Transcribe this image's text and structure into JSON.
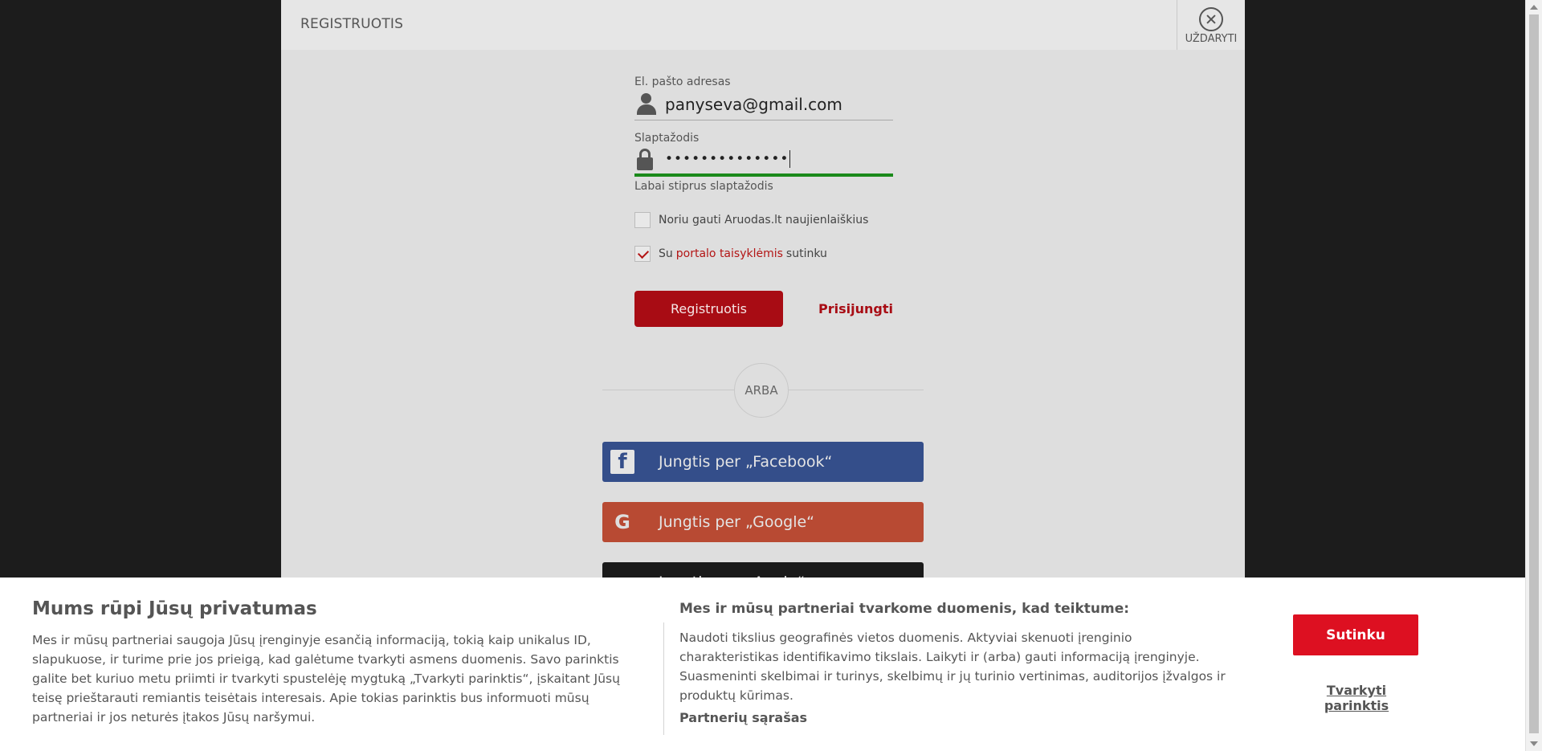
{
  "modal": {
    "title": "REGISTRUOTIS",
    "close_label": "UŽDARYTI"
  },
  "form": {
    "email_label": "El. pašto adresas",
    "email_value": "panyseva@gmail.com",
    "password_label": "Slaptažodis",
    "password_value": "••••••••••••••",
    "strength_text": "Labai stiprus slaptažodis",
    "newsletter_label": "Noriu gauti Aruodas.lt naujienlaiškius",
    "newsletter_checked": false,
    "terms_prefix": "Su",
    "terms_link": "portalo taisyklėmis",
    "terms_suffix": "sutinku",
    "terms_checked": true,
    "register_label": "Registruotis",
    "login_label": "Prisijungti"
  },
  "or_label": "ARBA",
  "social": {
    "facebook_label": "Jungtis per „Facebook“",
    "google_label": "Jungtis per „Google“",
    "apple_label": "Jungtis per „Apple“"
  },
  "cookie": {
    "title": "Mums rūpi Jūsų privatumas",
    "text": "Mes ir mūsų partneriai saugoja Jūsų įrenginyje esančią informaciją, tokią kaip unikalus ID, slapukuose, ir turime prie jos prieigą, kad galėtume tvarkyti asmens duomenis. Savo parinktis galite bet kuriuo metu priimti ir tvarkyti spustelėję mygtuką „Tvarkyti parinktis“, įskaitant Jūsų teisę prieštarauti remiantis teisėtais interesais. Apie tokias parinktis bus informuoti mūsų partneriai ir jos neturės įtakos Jūsų naršymui.",
    "subtitle": "Mes ir mūsų partneriai tvarkome duomenis, kad teiktume:",
    "purposes_text": "Naudoti tikslius geografinės vietos duomenis. Aktyviai skenuoti įrenginio charakteristikas identifikavimo tikslais. Laikyti ir (arba) gauti informaciją įrenginyje. Suasmeninti skelbimai ir turinys, skelbimų ir jų turinio vertinimas, auditorijos įžvalgos ir produktų kūrimas.",
    "partners_link": "Partnerių sąrašas",
    "agree_label": "Sutinku",
    "manage_label": "Tvarkyti parinktis"
  },
  "colors": {
    "brand_red": "#a80c14",
    "agree_red": "#dd1021",
    "strength_green": "#1a8a1a",
    "facebook_blue": "#344e8a",
    "google_orange": "#b84a33"
  }
}
